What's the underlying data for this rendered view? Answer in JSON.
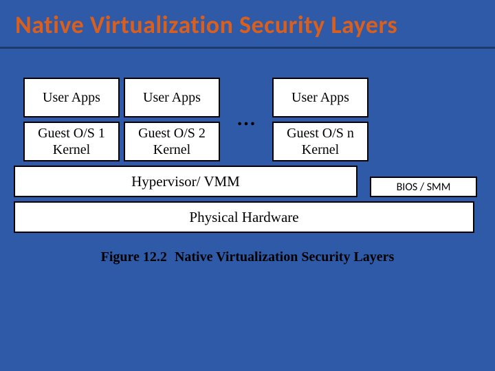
{
  "title": "Native Virtualization Security Layers",
  "guests": [
    {
      "apps": "User Apps",
      "kernel_line1": "Guest O/S 1",
      "kernel_line2": "Kernel"
    },
    {
      "apps": "User Apps",
      "kernel_line1": "Guest O/S 2",
      "kernel_line2": "Kernel"
    },
    {
      "apps": "User Apps",
      "kernel_line1": "Guest O/S n",
      "kernel_line2": "Kernel"
    }
  ],
  "ellipsis": "…",
  "hypervisor": "Hypervisor/ VMM",
  "bios": "BIOS / SMM",
  "physical": "Physical Hardware",
  "caption_num": "Figure 12.2",
  "caption_title": "Native Virtualization Security Layers"
}
